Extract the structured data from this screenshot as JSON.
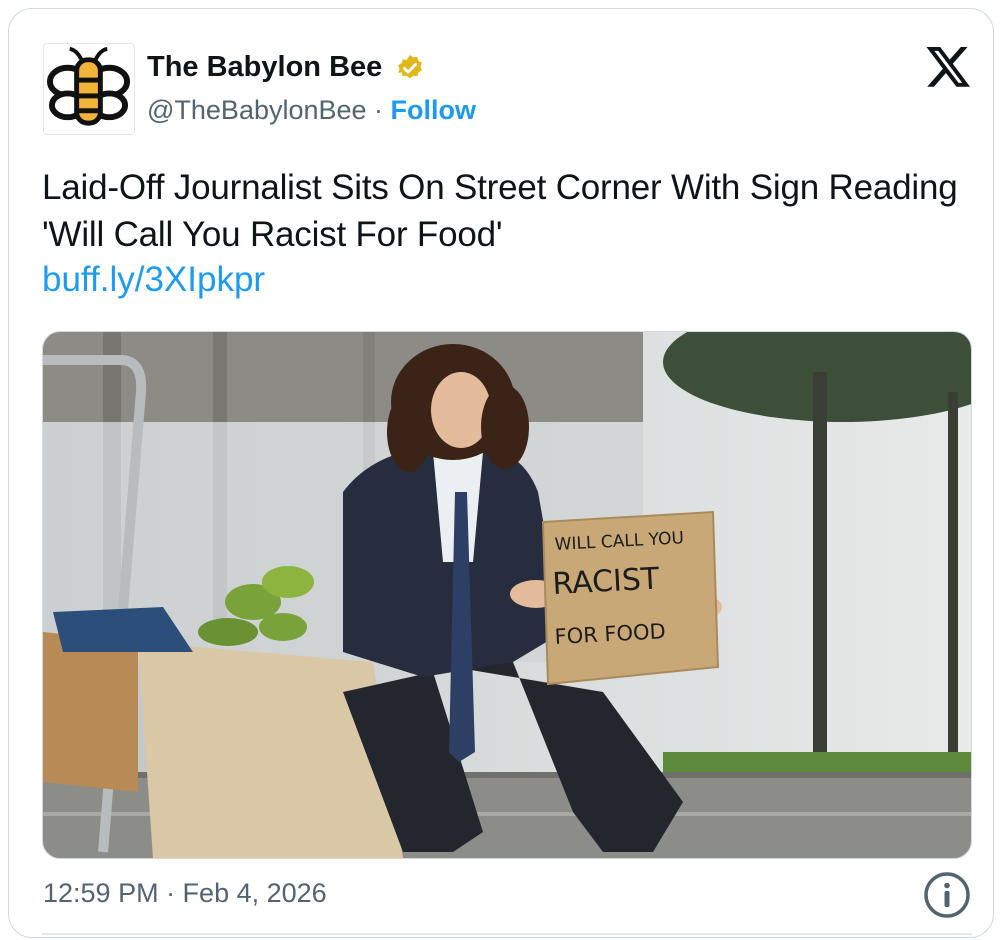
{
  "tweet": {
    "author_name": "The Babylon Bee",
    "handle": "@TheBabylonBee",
    "separator": " · ",
    "follow_label": "Follow",
    "headline": "Laid-Off Journalist Sits On Street Corner With Sign Reading 'Will Call You Racist For Food'",
    "link": "buff.ly/3XIpkpr",
    "timestamp": "12:59 PM · Feb 4, 2026",
    "verified": true
  },
  "sign": {
    "line1": "WILL CALL YOU",
    "line2": "RACIST",
    "line3": "FOR FOOD"
  },
  "colors": {
    "accent": "#1d9bf0",
    "secondary_text": "#536471",
    "verified_badge": "#e2b719",
    "bee_yellow": "#f4b43a"
  },
  "icons": {
    "verified": "verified-badge-icon",
    "platform": "x-logo-icon",
    "info": "info-icon",
    "avatar": "bee-logo-icon"
  }
}
